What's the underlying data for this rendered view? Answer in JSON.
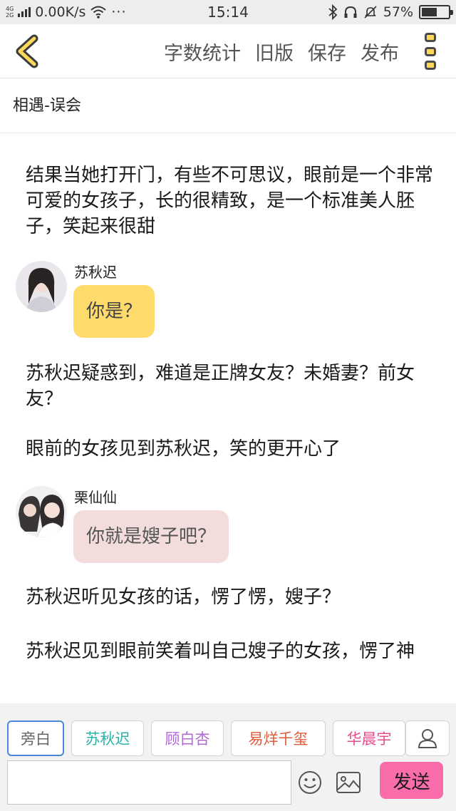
{
  "status_bar": {
    "network_type_top": "4G",
    "network_type_bottom": "2G",
    "speed": "0.00K/s",
    "more": "···",
    "time": "15:14",
    "battery": "57%",
    "battery_level": 0.57
  },
  "toolbar": {
    "back_icon": "chevron-left-icon",
    "actions": [
      "字数统计",
      "旧版",
      "保存",
      "发布"
    ],
    "more_icon": "vertical-dots-icon",
    "accent": "#ffd95a"
  },
  "chapter": {
    "title": "相遇-误会"
  },
  "content": {
    "p1": "结果当她打开门，有些不可思议，眼前是一个非常可爱的女孩子，长的很精致，是一个标准美人胚子，笑起来很甜",
    "msg1": {
      "name": "苏秋迟",
      "text": "你是？",
      "bubble_color": "#fedb6a"
    },
    "p2": "苏秋迟疑惑到，难道是正牌女友？未婚妻？前女友？",
    "p3": "眼前的女孩见到苏秋迟，笑的更开心了",
    "msg2": {
      "name": "栗仙仙",
      "text": "你就是嫂子吧？",
      "bubble_color": "#f3dcdc"
    },
    "p4": "苏秋迟听见女孩的话，愣了愣，嫂子？",
    "p5": "苏秋迟见到眼前笑着叫自己嫂子的女孩，愣了神"
  },
  "roles": [
    {
      "label": "旁白",
      "color": "#666666",
      "active": true
    },
    {
      "label": "苏秋迟",
      "color": "#2bb3a8",
      "active": false
    },
    {
      "label": "顾白杏",
      "color": "#b06ad6",
      "active": false
    },
    {
      "label": "易烊千玺",
      "color": "#e05a3a",
      "active": false
    },
    {
      "label": "华晨宇",
      "color": "#e34d8d",
      "active": false
    }
  ],
  "composer": {
    "input_value": "",
    "user_icon": "user-icon",
    "emoji_icon": "smiley-icon",
    "image_icon": "image-icon",
    "send_label": "发送",
    "send_color": "#fb6cab"
  }
}
